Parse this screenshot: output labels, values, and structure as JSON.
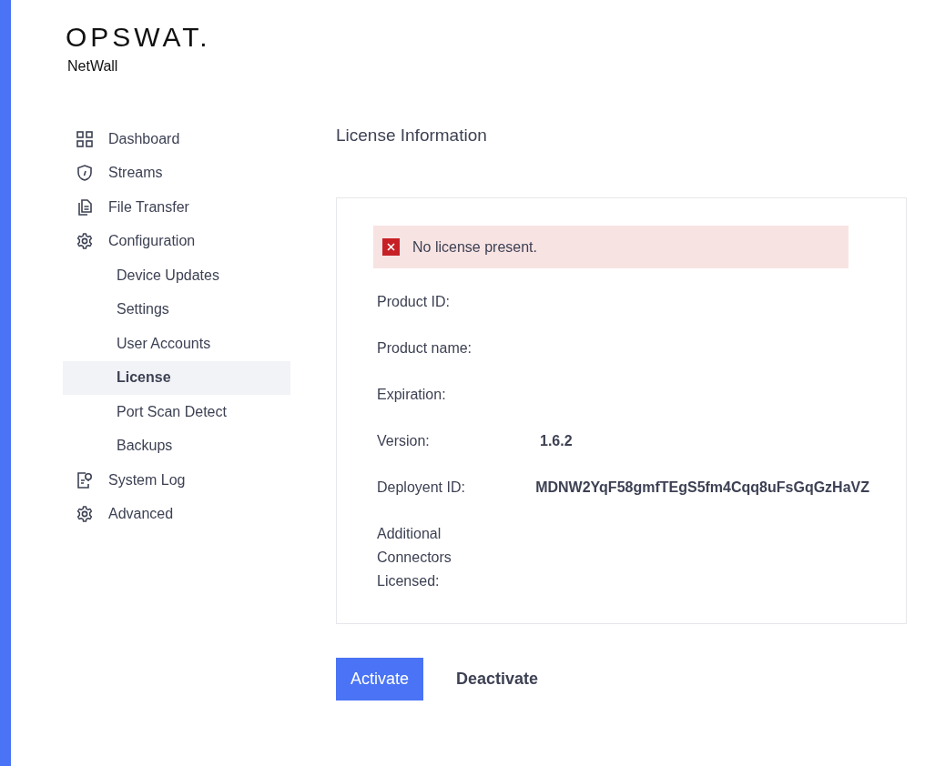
{
  "brand": {
    "logo": "OPSWAT.",
    "product": "NetWall"
  },
  "sidebar": {
    "items": [
      {
        "label": "Dashboard",
        "kind": "grid",
        "selected": false
      },
      {
        "label": "Streams",
        "kind": "shield",
        "selected": false
      },
      {
        "label": "File Transfer",
        "kind": "files",
        "selected": false
      },
      {
        "label": "Configuration",
        "kind": "gear",
        "selected": false,
        "children": [
          {
            "label": "Device Updates",
            "selected": false
          },
          {
            "label": "Settings",
            "selected": false
          },
          {
            "label": "User Accounts",
            "selected": false
          },
          {
            "label": "License",
            "selected": true
          },
          {
            "label": "Port Scan Detect",
            "selected": false
          },
          {
            "label": "Backups",
            "selected": false
          }
        ]
      },
      {
        "label": "System Log",
        "kind": "log",
        "selected": false
      },
      {
        "label": "Advanced",
        "kind": "gear",
        "selected": false
      }
    ]
  },
  "page": {
    "title": "License Information",
    "alert": {
      "kind": "error",
      "text": "No license present."
    },
    "fields": [
      {
        "label": "Product ID:"
      },
      {
        "label": "Product name:"
      },
      {
        "label": "Expiration:"
      },
      {
        "label": "Version:",
        "value": "1.6.2"
      },
      {
        "label": "Deployent ID:",
        "value": "MDNW2YqF58gmfTEgS5fm4Cqq8uFsGqGzHaVZ"
      },
      {
        "label": "Additional Connectors Licensed:"
      }
    ],
    "buttons": [
      {
        "label": "Activate",
        "kind": "primary"
      },
      {
        "label": "Deactivate",
        "kind": "plain"
      }
    ]
  }
}
